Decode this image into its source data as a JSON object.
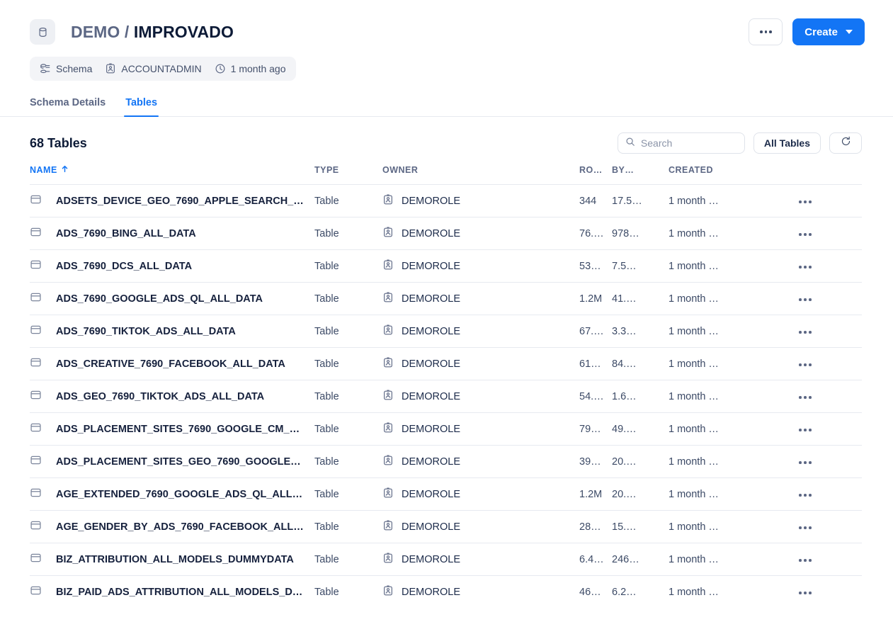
{
  "header": {
    "db_icon": "database-icon",
    "title_prefix": "DEMO",
    "title_separator": "/",
    "title_main": "IMPROVADO",
    "more_button_label": "",
    "create_button_label": "Create"
  },
  "meta": {
    "items": [
      {
        "icon": "schema-icon",
        "label": "Schema"
      },
      {
        "icon": "role-badge-icon",
        "label": "ACCOUNTADMIN"
      },
      {
        "icon": "clock-icon",
        "label": "1 month ago"
      }
    ]
  },
  "tabs": [
    {
      "label": "Schema Details",
      "active": false
    },
    {
      "label": "Tables",
      "active": true
    }
  ],
  "toolbar": {
    "count_label": "68 Tables",
    "search_placeholder": "Search",
    "search_value": "",
    "filter_label": "All Tables",
    "refresh_label": "refresh-icon"
  },
  "table": {
    "columns": [
      {
        "key": "name",
        "label": "NAME",
        "sorted": true,
        "sort_direction": "asc"
      },
      {
        "key": "type",
        "label": "TYPE",
        "sorted": false
      },
      {
        "key": "owner",
        "label": "OWNER",
        "sorted": false
      },
      {
        "key": "rows",
        "label": "RO…",
        "sorted": false
      },
      {
        "key": "bytes",
        "label": "BY…",
        "sorted": false
      },
      {
        "key": "created",
        "label": "CREATED",
        "sorted": false
      }
    ],
    "rows": [
      {
        "name": "ADSETS_DEVICE_GEO_7690_APPLE_SEARCH_…",
        "type": "Table",
        "owner": "DEMOROLE",
        "rows": "344",
        "bytes": "17.5…",
        "created": "1 month …"
      },
      {
        "name": "ADS_7690_BING_ALL_DATA",
        "type": "Table",
        "owner": "DEMOROLE",
        "rows": "76.…",
        "bytes": "978…",
        "created": "1 month …"
      },
      {
        "name": "ADS_7690_DCS_ALL_DATA",
        "type": "Table",
        "owner": "DEMOROLE",
        "rows": "53…",
        "bytes": "7.5…",
        "created": "1 month …"
      },
      {
        "name": "ADS_7690_GOOGLE_ADS_QL_ALL_DATA",
        "type": "Table",
        "owner": "DEMOROLE",
        "rows": "1.2M",
        "bytes": "41.…",
        "created": "1 month …"
      },
      {
        "name": "ADS_7690_TIKTOK_ADS_ALL_DATA",
        "type": "Table",
        "owner": "DEMOROLE",
        "rows": "67.…",
        "bytes": "3.3…",
        "created": "1 month …"
      },
      {
        "name": "ADS_CREATIVE_7690_FACEBOOK_ALL_DATA",
        "type": "Table",
        "owner": "DEMOROLE",
        "rows": "61…",
        "bytes": "84.…",
        "created": "1 month …"
      },
      {
        "name": "ADS_GEO_7690_TIKTOK_ADS_ALL_DATA",
        "type": "Table",
        "owner": "DEMOROLE",
        "rows": "54.…",
        "bytes": "1.6…",
        "created": "1 month …"
      },
      {
        "name": "ADS_PLACEMENT_SITES_7690_GOOGLE_CM_…",
        "type": "Table",
        "owner": "DEMOROLE",
        "rows": "79…",
        "bytes": "49.…",
        "created": "1 month …"
      },
      {
        "name": "ADS_PLACEMENT_SITES_GEO_7690_GOOGLE…",
        "type": "Table",
        "owner": "DEMOROLE",
        "rows": "39…",
        "bytes": "20.…",
        "created": "1 month …"
      },
      {
        "name": "AGE_EXTENDED_7690_GOOGLE_ADS_QL_ALL…",
        "type": "Table",
        "owner": "DEMOROLE",
        "rows": "1.2M",
        "bytes": "20.…",
        "created": "1 month …"
      },
      {
        "name": "AGE_GENDER_BY_ADS_7690_FACEBOOK_ALL…",
        "type": "Table",
        "owner": "DEMOROLE",
        "rows": "28…",
        "bytes": "15.…",
        "created": "1 month …"
      },
      {
        "name": "BIZ_ATTRIBUTION_ALL_MODELS_DUMMYDATA",
        "type": "Table",
        "owner": "DEMOROLE",
        "rows": "6.4…",
        "bytes": "246…",
        "created": "1 month …"
      },
      {
        "name": "BIZ_PAID_ADS_ATTRIBUTION_ALL_MODELS_D…",
        "type": "Table",
        "owner": "DEMOROLE",
        "rows": "46…",
        "bytes": "6.2…",
        "created": "1 month …"
      }
    ]
  },
  "colors": {
    "accent": "#1375f5",
    "text": "#1c2b4a",
    "muted": "#5c6784",
    "border": "#e7eaf0",
    "pill_bg": "#f3f4f7"
  }
}
